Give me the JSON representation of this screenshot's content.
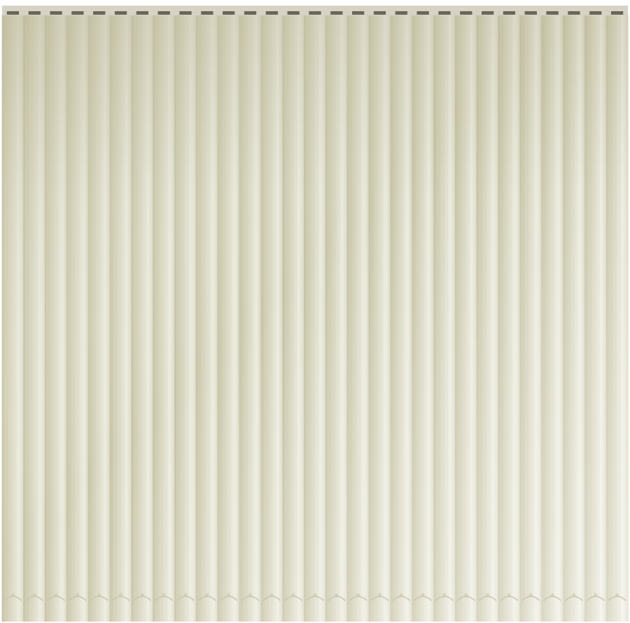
{
  "scene": {
    "subject": "vertical-blinds",
    "slat_count": 29,
    "colors": {
      "background": "#ffffff",
      "headrail": "#d6d3c4",
      "carrier": "#5f5a4d",
      "fabric_dark": "#c6c3a4",
      "fabric_mid": "#d9d7c1",
      "fabric_light": "#efeee2",
      "shadow": "#a8a588",
      "chain": "#c9c6ad"
    }
  }
}
